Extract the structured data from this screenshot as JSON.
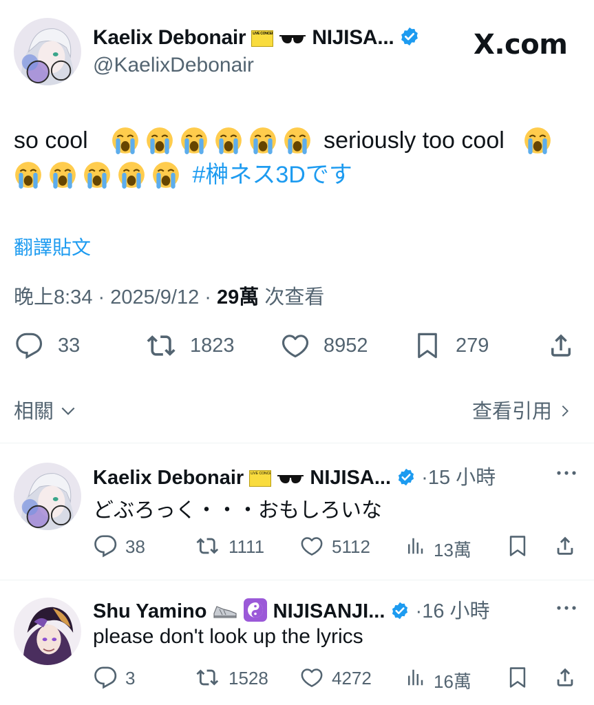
{
  "site_badge": "X.com",
  "main_post": {
    "display_name": "Kaelix Debonair",
    "name_suffix": "NIJISA...",
    "handle": "@KaelixDebonair",
    "text_1": "so cool",
    "text_2": "seriously too cool",
    "hashtag": "#榊ネス3Dです",
    "translate": "翻譯貼文",
    "time": "晚上8:34 · 2025/9/12 ·",
    "views_count": "29萬",
    "views_label": "次查看",
    "stats": {
      "replies": "33",
      "reposts": "1823",
      "likes": "8952",
      "bookmarks": "279"
    },
    "related_label": "相關",
    "quotes_label": "查看引用"
  },
  "replies": [
    {
      "display_name": "Kaelix Debonair",
      "name_suffix": "NIJISA...",
      "time": "·15 小時",
      "text": "どぶろっく・・・おもしろいな",
      "replies": "38",
      "reposts": "1111",
      "likes": "5112",
      "views": "13萬"
    },
    {
      "display_name": "Shu Yamino",
      "name_suffix": "NIJISANJI...",
      "time": "·16 小時",
      "text": "please don't look up the lyrics",
      "replies": "3",
      "reposts": "1528",
      "likes": "4272",
      "views": "16萬"
    }
  ],
  "ticket_text": "LIVE CONCERT TICKET",
  "colors": {
    "accent": "#1d9bf0",
    "text": "#0f1419",
    "secondary": "#536471",
    "divider": "#eff3f4"
  }
}
